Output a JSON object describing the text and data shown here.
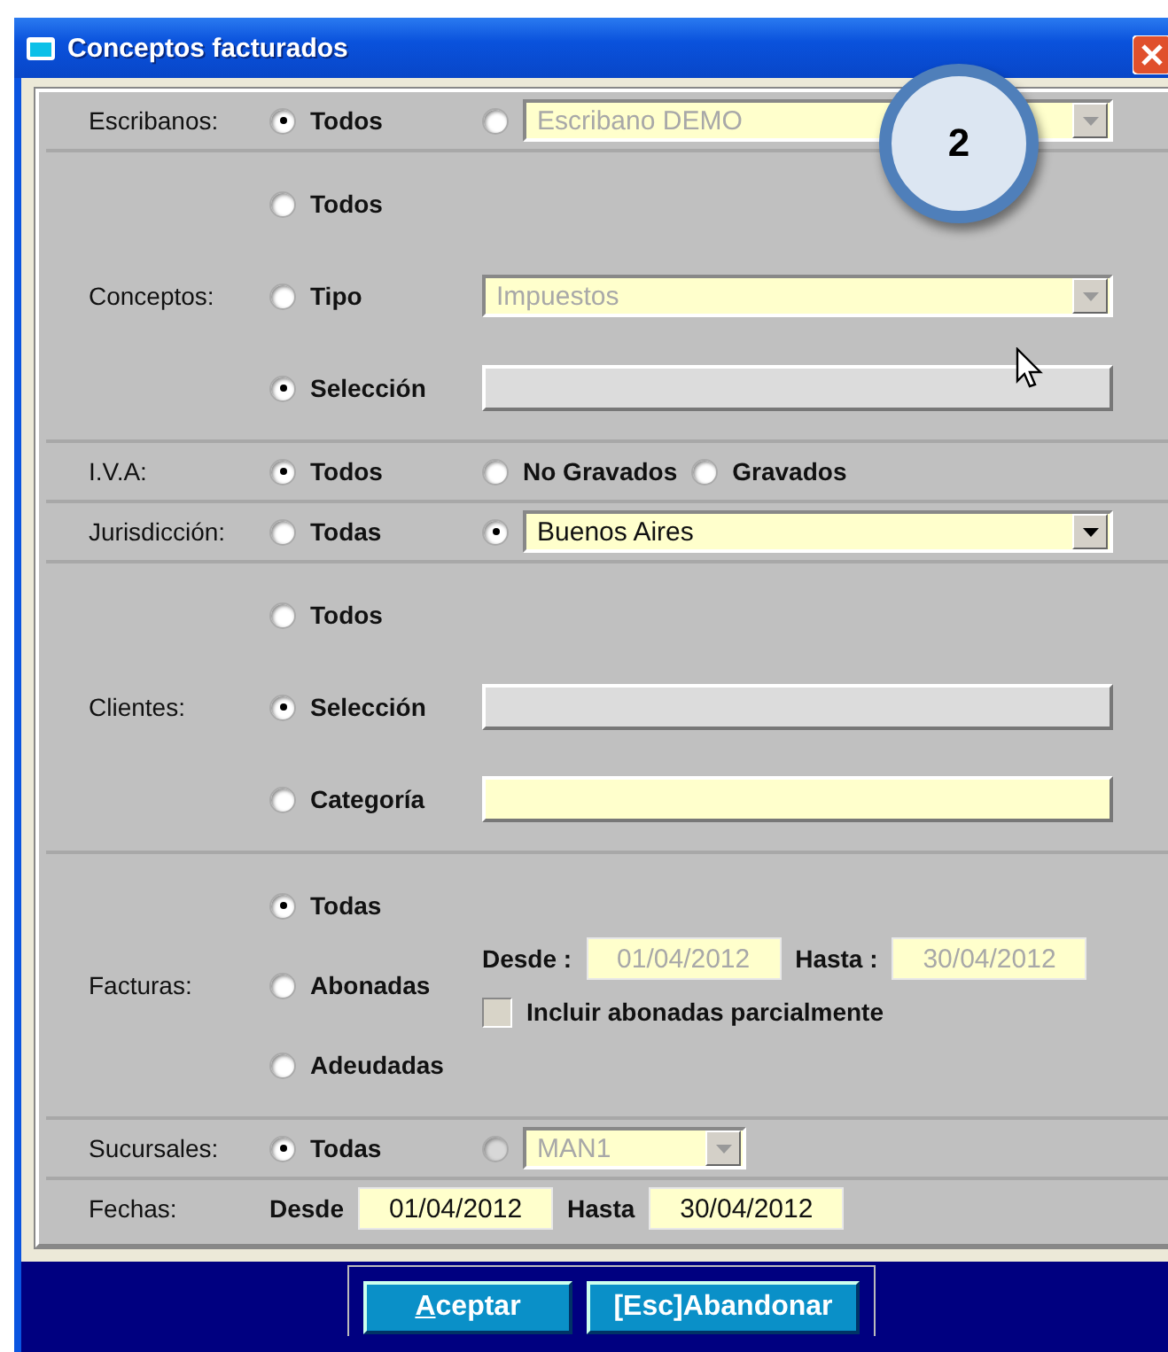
{
  "window": {
    "title": "Conceptos facturados"
  },
  "sections": [
    {
      "label": "Escribanos:",
      "lines": [
        [
          {
            "kind": "radio",
            "label": "Todos",
            "selected": true,
            "disabled": false
          },
          {
            "kind": "radio",
            "selected": false,
            "disabled": false
          },
          {
            "kind": "combo",
            "value": "Escribano DEMO",
            "disabled": true
          }
        ]
      ]
    },
    {
      "label": "Conceptos:",
      "lines": [
        [
          {
            "kind": "radio",
            "label": "Todos",
            "selected": false,
            "disabled": false
          }
        ],
        [
          {
            "kind": "radio",
            "label": "Tipo",
            "selected": false,
            "disabled": false
          },
          {
            "kind": "combo",
            "value": "Impuestos",
            "disabled": true
          }
        ],
        [
          {
            "kind": "radio",
            "label": "Selección",
            "selected": true,
            "disabled": false
          },
          {
            "kind": "field",
            "disabled": true
          }
        ]
      ]
    },
    {
      "label": "I.V.A:",
      "lines": [
        [
          {
            "kind": "radio",
            "label": "Todos",
            "selected": true,
            "disabled": false
          },
          {
            "kind": "radio",
            "label": "No Gravados",
            "selected": false,
            "disabled": false
          },
          {
            "kind": "radio",
            "label": "Gravados",
            "selected": false,
            "disabled": false
          }
        ]
      ]
    },
    {
      "label": "Jurisdicción:",
      "lines": [
        [
          {
            "kind": "radio",
            "label": "Todas",
            "selected": false,
            "disabled": false
          },
          {
            "kind": "radio",
            "selected": true,
            "disabled": false
          },
          {
            "kind": "combo",
            "value": "Buenos Aires",
            "disabled": false
          }
        ]
      ]
    },
    {
      "label": "Clientes:",
      "lines": [
        [
          {
            "kind": "radio",
            "label": "Todos",
            "selected": false,
            "disabled": false
          }
        ],
        [
          {
            "kind": "radio",
            "label": "Selección",
            "selected": true,
            "disabled": false
          },
          {
            "kind": "field",
            "disabled": true
          }
        ],
        [
          {
            "kind": "radio",
            "label": "Categoría",
            "selected": false,
            "disabled": false
          },
          {
            "kind": "field",
            "disabled": false
          }
        ]
      ]
    },
    {
      "label": "Facturas:",
      "lines": [
        [
          {
            "kind": "radio",
            "label": "Todas",
            "selected": true,
            "disabled": false
          }
        ],
        [
          {
            "kind": "radio",
            "label": "Abonadas",
            "selected": false,
            "disabled": false
          },
          {
            "kind": "stack",
            "lines": [
              [
                {
                  "kind": "text",
                  "label": "Desde :"
                },
                {
                  "kind": "date",
                  "value": "01/04/2012",
                  "disabled": true
                },
                {
                  "kind": "text",
                  "label": "Hasta :"
                },
                {
                  "kind": "date",
                  "value": "30/04/2012",
                  "disabled": true
                }
              ],
              [
                {
                  "kind": "checkbox",
                  "label": "Incluir abonadas parcialmente",
                  "checked": false,
                  "disabled": true
                }
              ]
            ]
          }
        ],
        [
          {
            "kind": "radio",
            "label": "Adeudadas",
            "selected": false,
            "disabled": false
          }
        ]
      ]
    },
    {
      "label": "Sucursales:",
      "lines": [
        [
          {
            "kind": "radio",
            "label": "Todas",
            "selected": true,
            "disabled": false
          },
          {
            "kind": "radio",
            "selected": false,
            "disabled": true
          },
          {
            "kind": "short_combo",
            "value": "MAN1",
            "disabled": true
          }
        ]
      ]
    },
    {
      "label": "Fechas:",
      "lines": [
        [
          {
            "kind": "text",
            "label": "Desde"
          },
          {
            "kind": "date",
            "value": "01/04/2012",
            "disabled": false
          },
          {
            "kind": "text",
            "label": "Hasta"
          },
          {
            "kind": "date",
            "value": "30/04/2012",
            "disabled": false
          }
        ]
      ]
    }
  ],
  "buttons": [
    {
      "label": "Aceptar",
      "mnemonic": true
    },
    {
      "label": "[Esc]Abandonar",
      "mnemonic": false
    }
  ],
  "callout": {
    "label": "2"
  }
}
